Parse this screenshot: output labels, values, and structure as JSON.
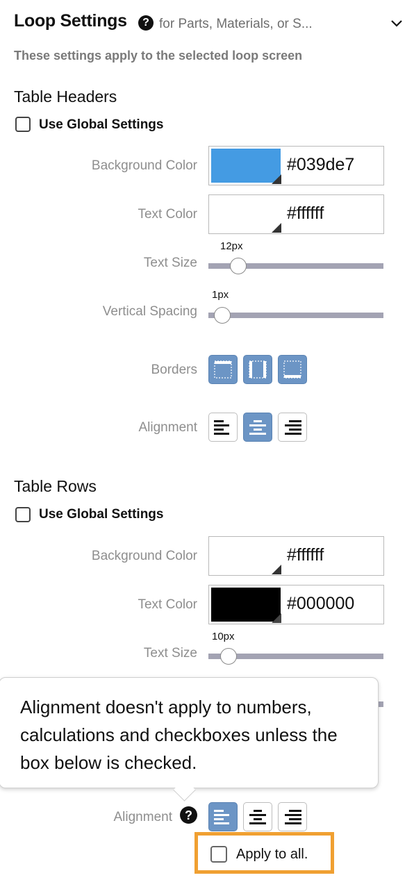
{
  "header": {
    "title": "Loop Settings",
    "help_glyph": "?",
    "subtitle": "for Parts, Materials, or S...",
    "description": "These settings apply to the selected loop screen"
  },
  "table_headers": {
    "section_title": "Table Headers",
    "use_global_label": "Use Global Settings",
    "use_global_checked": false,
    "background_color": {
      "label": "Background Color",
      "value": "#039de7",
      "swatch": "#449be3"
    },
    "text_color": {
      "label": "Text Color",
      "value": "#ffffff",
      "swatch": "#ffffff"
    },
    "text_size": {
      "label": "Text Size",
      "value": "12px",
      "level": 0.1
    },
    "vertical_spacing": {
      "label": "Vertical Spacing",
      "value": "1px",
      "level": 0.0
    },
    "borders": {
      "label": "Borders",
      "icons": [
        "border-top-icon",
        "border-sides-icon",
        "border-bottom-icon"
      ],
      "active": [
        true,
        true,
        true
      ]
    },
    "alignment": {
      "label": "Alignment",
      "icons": [
        "align-left-icon",
        "align-center-icon",
        "align-right-icon"
      ],
      "selected": "center"
    }
  },
  "table_rows": {
    "section_title": "Table Rows",
    "use_global_label": "Use Global Settings",
    "use_global_checked": false,
    "background_color": {
      "label": "Background Color",
      "value": "#ffffff",
      "swatch": "#ffffff"
    },
    "text_color": {
      "label": "Text Color",
      "value": "#000000",
      "swatch": "#000000"
    },
    "text_size": {
      "label": "Text Size",
      "value": "10px",
      "level": 0.04
    },
    "alignment": {
      "label": "Alignment",
      "help_glyph": "?",
      "icons": [
        "align-left-icon",
        "align-center-icon",
        "align-right-icon"
      ],
      "selected": "left"
    },
    "apply_to_all_label": "Apply to all.",
    "apply_to_all_checked": false
  },
  "tooltip": {
    "text": "Alignment doesn't apply to numbers, calculations and checkboxes unless the box below is checked."
  },
  "colors": {
    "active_button": "#6c95c5",
    "highlight": "#f0a032",
    "slider_track": "#a3a3b3"
  }
}
